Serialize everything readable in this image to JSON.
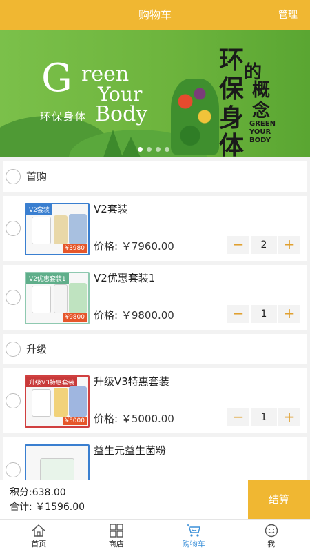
{
  "header": {
    "title": "购物车",
    "manage_label": "管理"
  },
  "banner": {
    "brand_line1": "reen",
    "brand_line2": "Your",
    "brand_line3": "Body",
    "brand_g": "G",
    "brand_cn": "环保身体",
    "slogan": {
      "c1": "环",
      "c2": "的",
      "c3": "保",
      "c4": "概",
      "c5": "身",
      "c6": "念",
      "c7": "体",
      "en": "GREEN YOUR BODY"
    }
  },
  "shops": [
    {
      "name": "首购",
      "items": [
        {
          "name": "V2套装",
          "price": "价格: ￥7960.00",
          "qty": "2",
          "thumb_tag": "V2套装",
          "thumb_price": "¥3980"
        },
        {
          "name": "V2优惠套装1",
          "price": "价格: ￥9800.00",
          "qty": "1",
          "thumb_tag": "V2优惠套装1",
          "thumb_price": "¥9800"
        }
      ]
    },
    {
      "name": "升级",
      "items": [
        {
          "name": "升级V3特惠套装",
          "price": "价格: ￥5000.00",
          "qty": "1",
          "thumb_tag": "升级V3特惠套装",
          "thumb_price": "¥5000"
        },
        {
          "name": "益生元益生菌粉"
        }
      ]
    }
  ],
  "summary": {
    "points": "积分:638.00",
    "total": "合计: ￥1596.00",
    "checkout_label": "结算"
  },
  "tabs": [
    {
      "label": "首页",
      "icon": "home-icon"
    },
    {
      "label": "商店",
      "icon": "grid-icon"
    },
    {
      "label": "购物车",
      "icon": "cart-icon",
      "active": true
    },
    {
      "label": "我",
      "icon": "smile-icon"
    }
  ],
  "colors": {
    "accent": "#f0b732",
    "active_tab": "#3a8fd8",
    "stepper_sign": "#e0a030"
  }
}
